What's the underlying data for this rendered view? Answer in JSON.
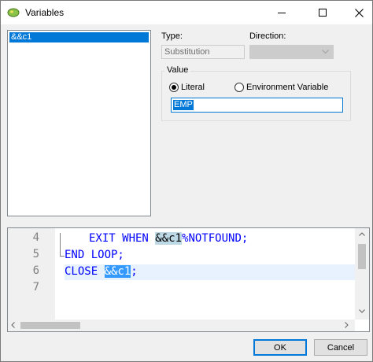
{
  "window": {
    "title": "Variables",
    "icon": "app-icon",
    "controls": [
      "minimize-icon",
      "maximize-icon",
      "close-icon"
    ]
  },
  "variables": {
    "items": [
      "&&c1"
    ],
    "selected": 0
  },
  "type": {
    "label": "Type:",
    "value": "Substitution"
  },
  "direction": {
    "label": "Direction:",
    "value": ""
  },
  "value_group": {
    "legend": "Value",
    "options": [
      "Literal",
      "Environment Variable"
    ],
    "selected": "Literal",
    "text": "EMP"
  },
  "code": {
    "line_numbers": [
      "4",
      "5",
      "6",
      "7"
    ],
    "lines": {
      "l4_kw": "EXIT WHEN ",
      "l4_var": "&&c1",
      "l4_rest": "%NOTFOUND;",
      "l5_kw": "END LOOP;",
      "l6_kw": "CLOSE ",
      "l6_var": "&&c1",
      "l6_rest": ";"
    }
  },
  "buttons": {
    "ok": "OK",
    "cancel": "Cancel"
  },
  "colors": {
    "accent": "#0078d7",
    "keyword": "#0000ff",
    "selection": "#3399ff",
    "current_line": "#e8f2fe"
  }
}
